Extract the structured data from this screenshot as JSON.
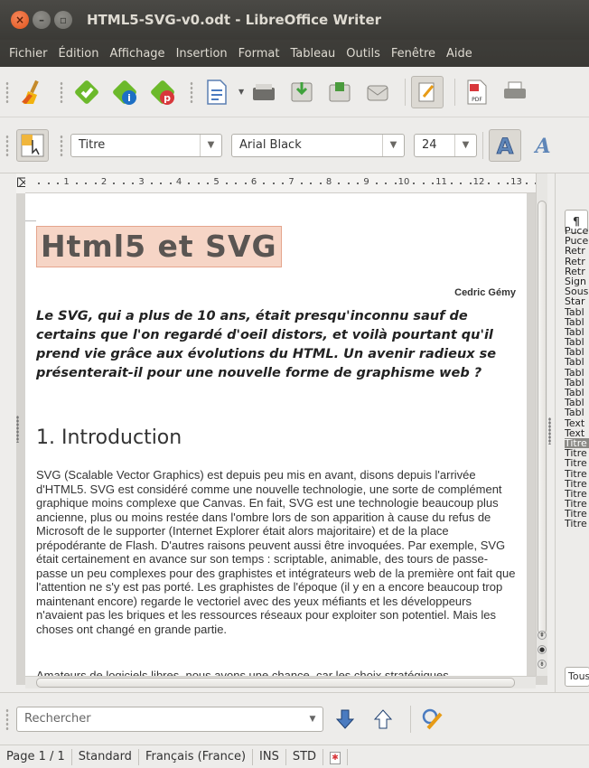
{
  "window": {
    "title": "HTML5-SVG-v0.odt - LibreOffice Writer"
  },
  "menu": [
    "Fichier",
    "Édition",
    "Affichage",
    "Insertion",
    "Format",
    "Tableau",
    "Outils",
    "Fenêtre",
    "Aide"
  ],
  "formatting": {
    "style": "Titre",
    "font": "Arial Black",
    "size": "24"
  },
  "ruler": [
    "1",
    "2",
    "3",
    "4",
    "5",
    "6",
    "7",
    "8",
    "9",
    "10",
    "11",
    "12",
    "13"
  ],
  "document": {
    "title": "Html5 et SVG",
    "author": "Cedric Gémy",
    "abstract": "Le SVG, qui a plus de 10 ans, était presqu'inconnu sauf de certains que l'on regardé d'oeil distors, et voilà pourtant qu'il prend vie grâce aux évolutions du HTML. Un avenir radieux se présenterait-il pour une nouvelle forme de graphisme web ?",
    "heading": "1. Introduction",
    "body": "SVG (Scalable Vector Graphics) est depuis peu mis en avant, disons depuis l'arrivée d'HTML5. SVG est considéré comme une nouvelle technologie, une sorte de complément graphique moins complexe que Canvas. En fait, SVG est une technologie beaucoup plus ancienne, plus ou moins restée dans l'ombre lors de son apparition à cause du refus de Microsoft de le supporter (Internet Explorer était alors majoritaire) et de la place prépodérante de Flash. D'autres raisons peuvent aussi être invoquées. Par exemple, SVG était certainement en avance sur son temps : scriptable, animable, des tours de passe-passe un peu complexes pour des graphistes et intégrateurs web de la première ont fait que l'attention ne s'y est pas porté. Les graphistes de l'époque (il y en a encore beaucoup trop maintenant encore) regarde le vectoriel avec des yeux méfiants et les développeurs n'avaient pas les briques et les ressources réseaux pour exploiter son potentiel. Mais les choses ont changé en grande partie.",
    "next_line": "Amateurs de logiciels libres, nous avons une chance, car les choix stratégiques"
  },
  "sidebar": {
    "tab": "¶",
    "styles": [
      "Puce",
      "Puce",
      "Retr",
      "Retr",
      "Retr",
      "Sign",
      "Sous",
      "Star",
      "Tabl",
      "Tabl",
      "Tabl",
      "Tabl",
      "Tabl",
      "Tabl",
      "Tabl",
      "Tabl",
      "Tabl",
      "Tabl",
      "Tabl",
      "Text",
      "Text",
      "Titre",
      "Titre",
      "Titre",
      "Titre",
      "Titre",
      "Titre",
      "Titre",
      "Titre",
      "Titre"
    ],
    "selected_index": 21,
    "filter": "Tous"
  },
  "find": {
    "placeholder": "Rechercher"
  },
  "status": {
    "page": "Page 1 / 1",
    "style": "Standard",
    "language": "Français (France)",
    "mode": "INS",
    "selection": "STD"
  },
  "colors": {
    "titlebar": "#3c3b37",
    "close": "#e0541c",
    "title_highlight": "#f6d5c6"
  }
}
